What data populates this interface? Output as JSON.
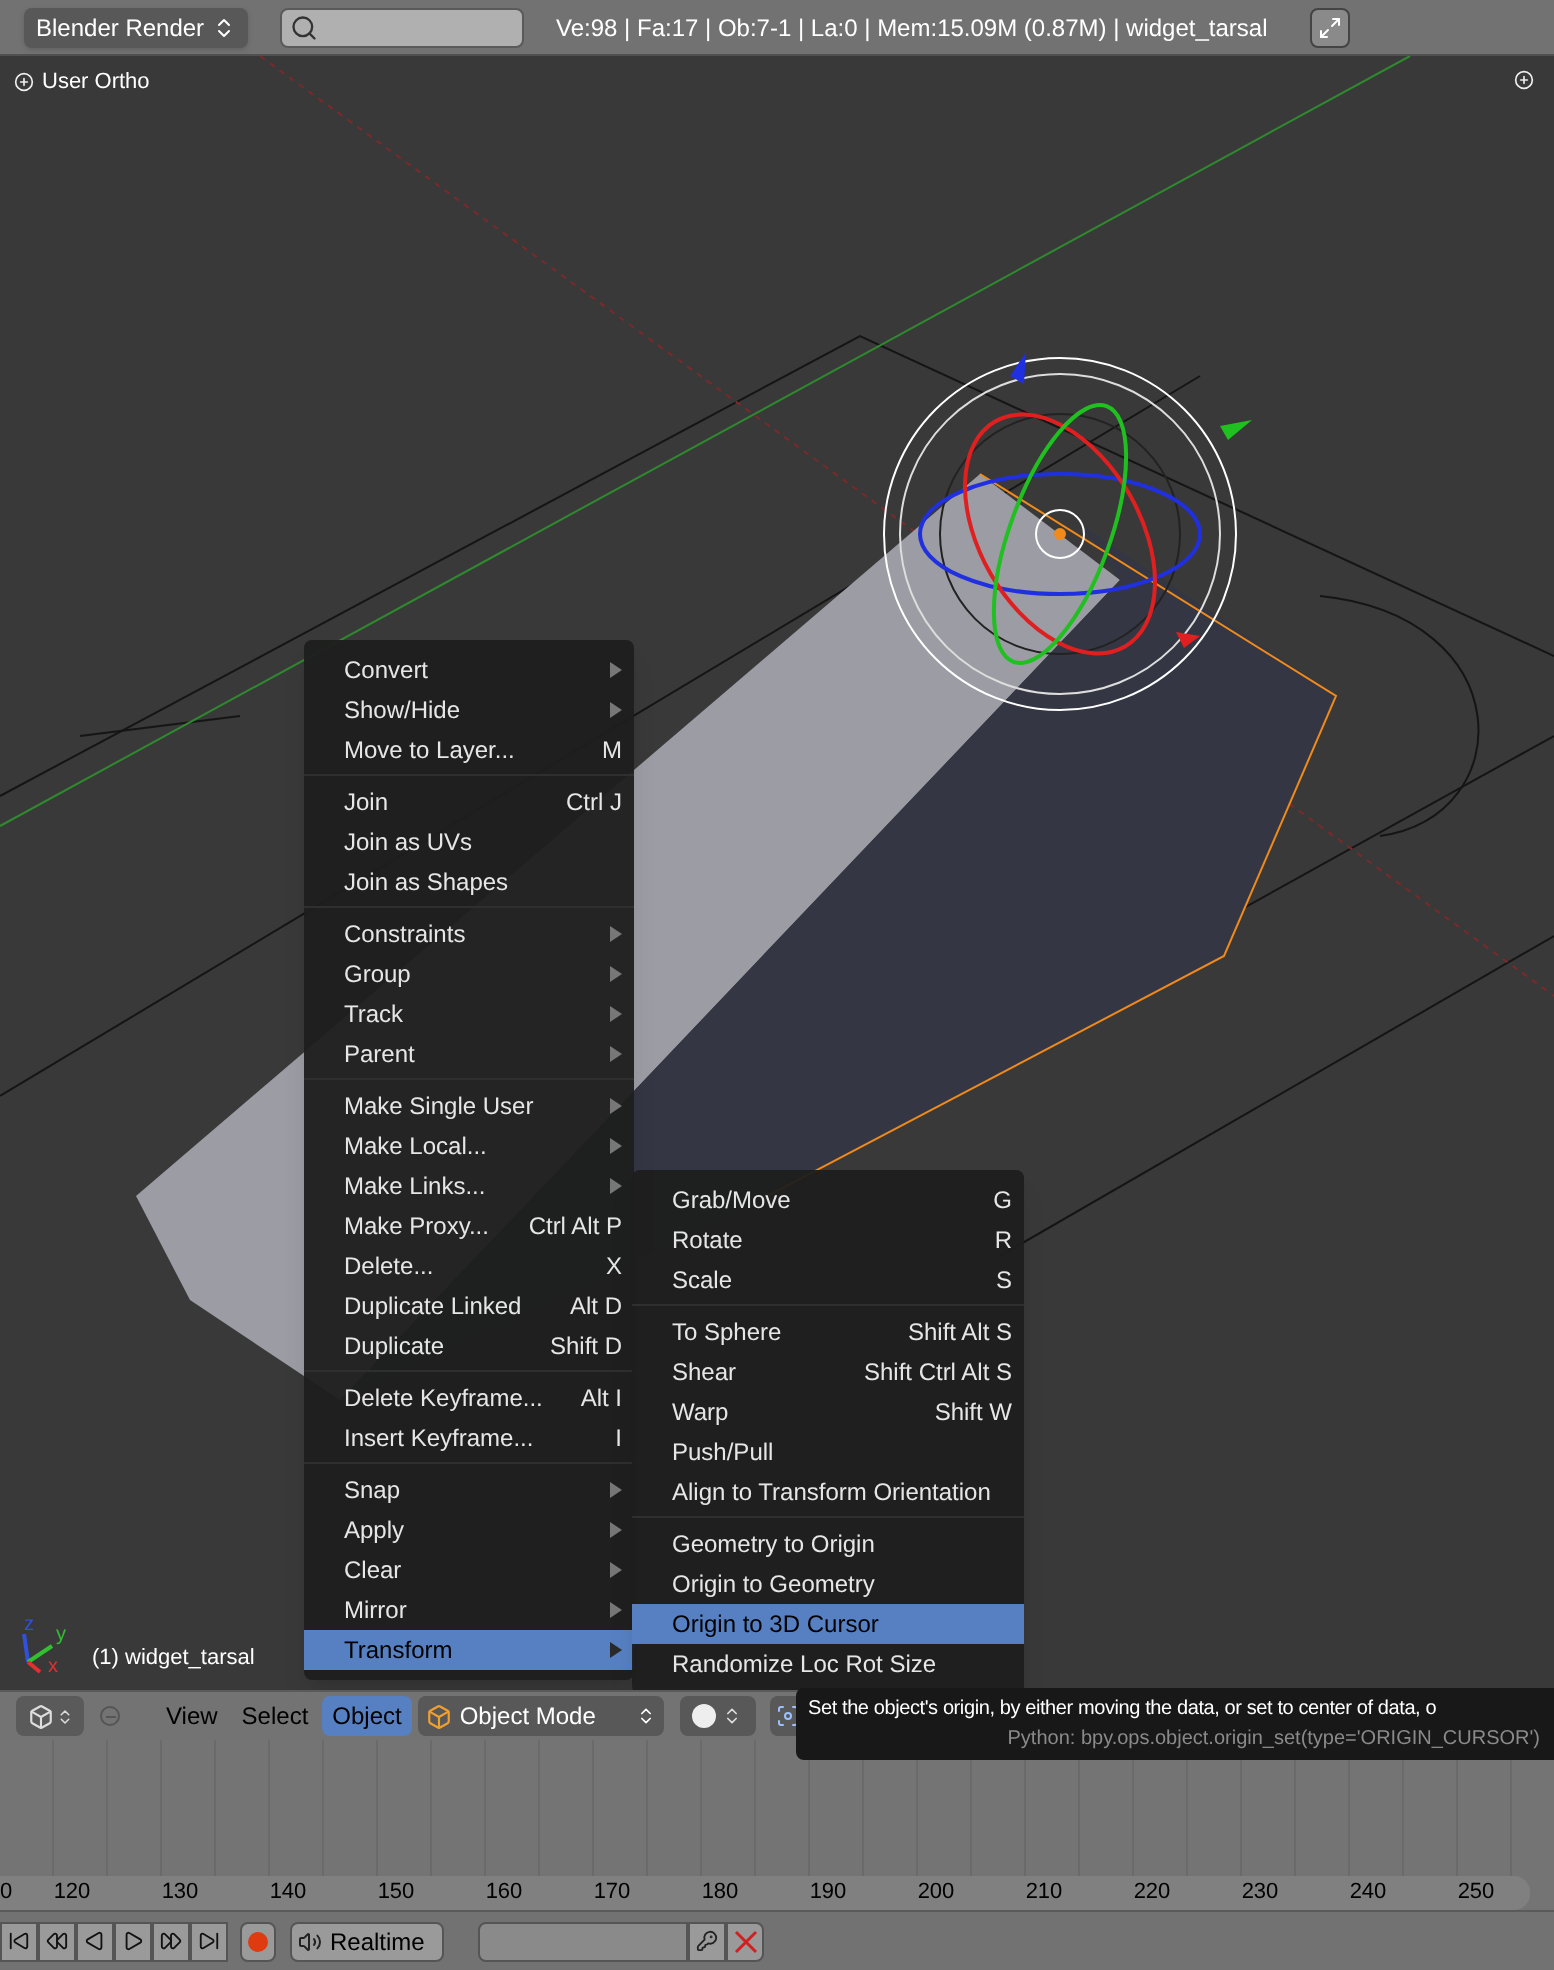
{
  "top_bar": {
    "render_engine": "Blender Render",
    "stats": "Ve:98 | Fa:17 | Ob:7-1 | La:0 | Mem:15.09M (0.87M) | widget_tarsal"
  },
  "viewport": {
    "view_label": "User Ortho",
    "object_label": "(1) widget_tarsal",
    "axes": [
      {
        "label": "x",
        "color": "#e03030"
      },
      {
        "label": "y",
        "color": "#30c030"
      },
      {
        "label": "z",
        "color": "#3050e0"
      }
    ]
  },
  "object_menu": {
    "sections": [
      [
        {
          "label": "Convert",
          "submenu": true,
          "selected": false
        },
        {
          "label": "Show/Hide",
          "submenu": true,
          "selected": false
        },
        {
          "label": "Move to Layer...",
          "shortcut": "M",
          "submenu": false,
          "selected": false
        }
      ],
      [
        {
          "label": "Join",
          "shortcut": "Ctrl J",
          "submenu": false,
          "selected": false
        },
        {
          "label": "Join as UVs",
          "submenu": false,
          "selected": false
        },
        {
          "label": "Join as Shapes",
          "submenu": false,
          "selected": false
        }
      ],
      [
        {
          "label": "Constraints",
          "submenu": true,
          "selected": false
        },
        {
          "label": "Group",
          "submenu": true,
          "selected": false
        },
        {
          "label": "Track",
          "submenu": true,
          "selected": false
        },
        {
          "label": "Parent",
          "submenu": true,
          "selected": false
        }
      ],
      [
        {
          "label": "Make Single User",
          "submenu": true,
          "selected": false
        },
        {
          "label": "Make Local...",
          "submenu": true,
          "selected": false
        },
        {
          "label": "Make Links...",
          "submenu": true,
          "selected": false
        },
        {
          "label": "Make Proxy...",
          "shortcut": "Ctrl Alt P",
          "submenu": false,
          "selected": false
        },
        {
          "label": "Delete...",
          "shortcut": "X",
          "submenu": false,
          "selected": false
        },
        {
          "label": "Duplicate Linked",
          "shortcut": "Alt D",
          "submenu": false,
          "selected": false
        },
        {
          "label": "Duplicate",
          "shortcut": "Shift D",
          "submenu": false,
          "selected": false
        }
      ],
      [
        {
          "label": "Delete Keyframe...",
          "shortcut": "Alt I",
          "submenu": false,
          "selected": false
        },
        {
          "label": "Insert Keyframe...",
          "shortcut": "I",
          "submenu": false,
          "selected": false
        }
      ],
      [
        {
          "label": "Snap",
          "submenu": true,
          "selected": false
        },
        {
          "label": "Apply",
          "submenu": true,
          "selected": false
        },
        {
          "label": "Clear",
          "submenu": true,
          "selected": false
        },
        {
          "label": "Mirror",
          "submenu": true,
          "selected": false
        },
        {
          "label": "Transform",
          "submenu": true,
          "selected": true
        }
      ]
    ]
  },
  "transform_menu": {
    "sections": [
      [
        {
          "label": "Grab/Move",
          "shortcut": "G",
          "submenu": false,
          "selected": false
        },
        {
          "label": "Rotate",
          "shortcut": "R",
          "submenu": false,
          "selected": false
        },
        {
          "label": "Scale",
          "shortcut": "S",
          "submenu": false,
          "selected": false
        }
      ],
      [
        {
          "label": "To Sphere",
          "shortcut": "Shift Alt S",
          "submenu": false,
          "selected": false
        },
        {
          "label": "Shear",
          "shortcut": "Shift Ctrl Alt S",
          "submenu": false,
          "selected": false
        },
        {
          "label": "Warp",
          "shortcut": "Shift W",
          "submenu": false,
          "selected": false
        },
        {
          "label": "Push/Pull",
          "submenu": false,
          "selected": false
        },
        {
          "label": "Align to Transform Orientation",
          "submenu": false,
          "selected": false
        }
      ],
      [
        {
          "label": "Geometry to Origin",
          "submenu": false,
          "selected": false
        },
        {
          "label": "Origin to Geometry",
          "submenu": false,
          "selected": false
        },
        {
          "label": "Origin to 3D Cursor",
          "submenu": false,
          "selected": true
        },
        {
          "label": "Randomize Loc Rot Size",
          "submenu": false,
          "selected": false
        }
      ]
    ]
  },
  "viewport_header": {
    "menus": [
      {
        "label": "View",
        "selected": false
      },
      {
        "label": "Select",
        "selected": false
      },
      {
        "label": "Object",
        "selected": true
      }
    ],
    "mode": "Object Mode"
  },
  "tooltip": {
    "description": "Set the object's origin, by either moving the data, or set to center of data, o",
    "python": "Python: bpy.ops.object.origin_set(type='ORIGIN_CURSOR')"
  },
  "timeline": {
    "ticks": [
      "0",
      "120",
      "130",
      "140",
      "150",
      "160",
      "170",
      "180",
      "190",
      "200",
      "210",
      "220",
      "230",
      "240",
      "250"
    ]
  },
  "playback": {
    "sync": "Realtime"
  }
}
